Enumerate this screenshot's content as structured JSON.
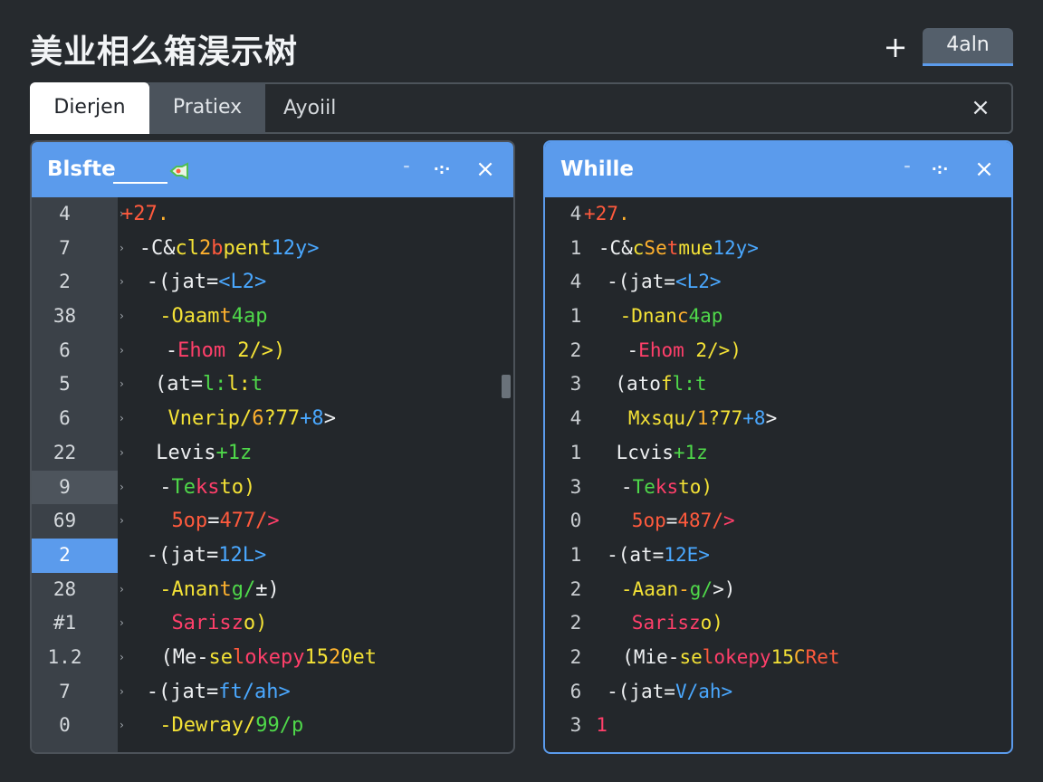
{
  "app_title": "美业相么箱淏示树",
  "top_actions": {
    "add_label": "+",
    "button_label": "4aln"
  },
  "tabs": [
    {
      "label": "Dierjen"
    },
    {
      "label": "Pratiex"
    }
  ],
  "search": {
    "value": "Ayoiil"
  },
  "icons": {
    "close": "×",
    "minimize": "⁼",
    "move": "·:·"
  },
  "colors": {
    "accent": "#5b9bec",
    "red": "#ff5a3d",
    "orange": "#ffb12e",
    "yellow": "#f4e236",
    "green": "#4fd84a",
    "pink": "#ff3f6a",
    "blue": "#4aa8ff",
    "white": "#eef0f2"
  },
  "left_panel": {
    "title": "Blsfte",
    "line_numbers": [
      "4",
      "7",
      "2",
      "38",
      "6",
      "5",
      "6",
      "22",
      "9",
      "69",
      "2",
      "28",
      "#1",
      "1.2",
      "7",
      "0"
    ],
    "lines": [
      {
        "indent": 0,
        "segments": [
          {
            "t": "+27",
            "c": "red"
          },
          {
            "t": ".",
            "c": "orange"
          }
        ]
      },
      {
        "indent": 1.5,
        "segments": [
          {
            "t": "-C&",
            "c": "white"
          },
          {
            "t": "cl",
            "c": "yellow"
          },
          {
            "t": "2",
            "c": "orange"
          },
          {
            "t": "b",
            "c": "red"
          },
          {
            "t": "pent",
            "c": "yellow"
          },
          {
            "t": "12y>",
            "c": "blue"
          }
        ]
      },
      {
        "indent": 2.1,
        "segments": [
          {
            "t": "-(jat=",
            "c": "white"
          },
          {
            "t": "<L2>",
            "c": "blue"
          }
        ]
      },
      {
        "indent": 3.2,
        "segments": [
          {
            "t": "-Oaam",
            "c": "yellow"
          },
          {
            "t": "t",
            "c": "orange"
          },
          {
            "t": "4ap",
            "c": "green"
          }
        ]
      },
      {
        "indent": 3.7,
        "segments": [
          {
            "t": "-",
            "c": "white"
          },
          {
            "t": "Ehom",
            "c": "pink"
          },
          {
            "t": " 2/>",
            "c": "yellow"
          },
          {
            "t": ")",
            "c": "yellow"
          }
        ]
      },
      {
        "indent": 2.8,
        "segments": [
          {
            "t": "(at=",
            "c": "white"
          },
          {
            "t": "l:",
            "c": "green"
          },
          {
            "t": "l:",
            "c": "yellow"
          },
          {
            "t": "t",
            "c": "green"
          }
        ]
      },
      {
        "indent": 3.9,
        "segments": [
          {
            "t": "Vnerip/",
            "c": "yellow"
          },
          {
            "t": "6",
            "c": "orange"
          },
          {
            "t": "?77",
            "c": "yellow"
          },
          {
            "t": "+8",
            "c": "blue"
          },
          {
            "t": ">",
            "c": "white"
          }
        ]
      },
      {
        "indent": 2.9,
        "segments": [
          {
            "t": "Levis",
            "c": "white"
          },
          {
            "t": "+1z",
            "c": "green"
          }
        ]
      },
      {
        "indent": 3.2,
        "segments": [
          {
            "t": "-",
            "c": "white"
          },
          {
            "t": "Te",
            "c": "green"
          },
          {
            "t": "ks",
            "c": "pink"
          },
          {
            "t": "to)",
            "c": "yellow"
          }
        ]
      },
      {
        "indent": 4.2,
        "segments": [
          {
            "t": "5op",
            "c": "red"
          },
          {
            "t": "=",
            "c": "white"
          },
          {
            "t": "477/",
            "c": "red"
          },
          {
            "t": ">",
            "c": "pink"
          }
        ]
      },
      {
        "indent": 2.1,
        "segments": [
          {
            "t": "-(jat=",
            "c": "white"
          },
          {
            "t": "12L>",
            "c": "blue"
          }
        ]
      },
      {
        "indent": 3.2,
        "segments": [
          {
            "t": "-Anan",
            "c": "yellow"
          },
          {
            "t": "t",
            "c": "orange"
          },
          {
            "t": "g/",
            "c": "green"
          },
          {
            "t": "±)",
            "c": "white"
          }
        ]
      },
      {
        "indent": 4.2,
        "segments": [
          {
            "t": "Sarisz",
            "c": "pink"
          },
          {
            "t": "o)",
            "c": "yellow"
          }
        ]
      },
      {
        "indent": 3.3,
        "segments": [
          {
            "t": "(Me-",
            "c": "white"
          },
          {
            "t": "se",
            "c": "yellow"
          },
          {
            "t": "l",
            "c": "red"
          },
          {
            "t": "okepy",
            "c": "pink"
          },
          {
            "t": "15",
            "c": "yellow"
          },
          {
            "t": "2",
            "c": "orange"
          },
          {
            "t": "0et",
            "c": "yellow"
          }
        ]
      },
      {
        "indent": 2.1,
        "segments": [
          {
            "t": "-(jat=",
            "c": "white"
          },
          {
            "t": "ft/",
            "c": "blue"
          },
          {
            "t": "ah>",
            "c": "blue"
          }
        ]
      },
      {
        "indent": 3.2,
        "segments": [
          {
            "t": "-Dewray/",
            "c": "yellow"
          },
          {
            "t": "99/",
            "c": "green"
          },
          {
            "t": "p",
            "c": "green"
          }
        ]
      }
    ]
  },
  "right_panel": {
    "title": "Whille",
    "line_numbers": [
      "4",
      "1",
      "4",
      "1",
      "2",
      "3",
      "4",
      "1",
      "3",
      "0",
      "1",
      "2",
      "2",
      "2",
      "6",
      "3"
    ],
    "lines": [
      {
        "indent": 0,
        "segments": [
          {
            "t": "+27",
            "c": "red"
          },
          {
            "t": ".",
            "c": "orange"
          }
        ]
      },
      {
        "indent": 1.2,
        "segments": [
          {
            "t": "-C&",
            "c": "white"
          },
          {
            "t": "c",
            "c": "yellow"
          },
          {
            "t": "Se",
            "c": "orange"
          },
          {
            "t": "t",
            "c": "red"
          },
          {
            "t": "mue",
            "c": "yellow"
          },
          {
            "t": "12y>",
            "c": "blue"
          }
        ]
      },
      {
        "indent": 1.9,
        "segments": [
          {
            "t": "-(jat=",
            "c": "white"
          },
          {
            "t": "<L2>",
            "c": "blue"
          }
        ]
      },
      {
        "indent": 3.0,
        "segments": [
          {
            "t": "-Dnan",
            "c": "yellow"
          },
          {
            "t": "c",
            "c": "orange"
          },
          {
            "t": "4ap",
            "c": "green"
          }
        ]
      },
      {
        "indent": 3.6,
        "segments": [
          {
            "t": "-",
            "c": "white"
          },
          {
            "t": "Ehom",
            "c": "pink"
          },
          {
            "t": " 2/>",
            "c": "yellow"
          },
          {
            "t": ")",
            "c": "yellow"
          }
        ]
      },
      {
        "indent": 2.6,
        "segments": [
          {
            "t": "(ato",
            "c": "white"
          },
          {
            "t": "f",
            "c": "yellow"
          },
          {
            "t": "l:",
            "c": "green"
          },
          {
            "t": "t",
            "c": "green"
          }
        ]
      },
      {
        "indent": 3.7,
        "segments": [
          {
            "t": "Mxsqu/",
            "c": "yellow"
          },
          {
            "t": "1",
            "c": "orange"
          },
          {
            "t": "?77",
            "c": "yellow"
          },
          {
            "t": "+8",
            "c": "blue"
          },
          {
            "t": ">",
            "c": "white"
          }
        ]
      },
      {
        "indent": 2.7,
        "segments": [
          {
            "t": "Lcvis",
            "c": "white"
          },
          {
            "t": "+1z",
            "c": "green"
          }
        ]
      },
      {
        "indent": 3.1,
        "segments": [
          {
            "t": "-",
            "c": "white"
          },
          {
            "t": "Te",
            "c": "green"
          },
          {
            "t": "ks",
            "c": "pink"
          },
          {
            "t": "to)",
            "c": "yellow"
          }
        ]
      },
      {
        "indent": 4.0,
        "segments": [
          {
            "t": "5op",
            "c": "red"
          },
          {
            "t": "=",
            "c": "white"
          },
          {
            "t": "487/",
            "c": "red"
          },
          {
            "t": ">",
            "c": "pink"
          }
        ]
      },
      {
        "indent": 1.9,
        "segments": [
          {
            "t": "-(at=",
            "c": "white"
          },
          {
            "t": "12E>",
            "c": "blue"
          }
        ]
      },
      {
        "indent": 3.1,
        "segments": [
          {
            "t": "-Aaan",
            "c": "yellow"
          },
          {
            "t": "-",
            "c": "orange"
          },
          {
            "t": "g/",
            "c": "green"
          },
          {
            "t": ">)",
            "c": "white"
          }
        ]
      },
      {
        "indent": 4.0,
        "segments": [
          {
            "t": "Sarisz",
            "c": "pink"
          },
          {
            "t": "o)",
            "c": "yellow"
          }
        ]
      },
      {
        "indent": 3.2,
        "segments": [
          {
            "t": "(Mie-",
            "c": "white"
          },
          {
            "t": "se",
            "c": "yellow"
          },
          {
            "t": "l",
            "c": "red"
          },
          {
            "t": "okepy",
            "c": "pink"
          },
          {
            "t": "15",
            "c": "yellow"
          },
          {
            "t": "C",
            "c": "orange"
          },
          {
            "t": "Ret",
            "c": "red"
          }
        ]
      },
      {
        "indent": 1.9,
        "segments": [
          {
            "t": "-(jat=",
            "c": "white"
          },
          {
            "t": "V/",
            "c": "blue"
          },
          {
            "t": "ah>",
            "c": "blue"
          }
        ]
      },
      {
        "indent": 1.0,
        "segments": [
          {
            "t": "1",
            "c": "pink"
          }
        ]
      }
    ]
  }
}
